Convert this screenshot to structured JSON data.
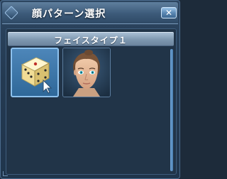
{
  "window": {
    "title": "顔パターン選択",
    "close_symbol": "✕"
  },
  "category": {
    "label": "フェイスタイプ１"
  },
  "faces": [
    {
      "id": "random",
      "icon": "dice-icon",
      "selected": true
    },
    {
      "id": "face-1",
      "icon": "face-portrait",
      "selected": false
    }
  ],
  "icons": {
    "close": "close-icon",
    "dice": "dice-icon",
    "cursor": "cursor-icon"
  },
  "colors": {
    "accent": "#8ec2ee",
    "header": "#7e97af",
    "window_bg": "#2c4560"
  },
  "scroll": {
    "position": 0
  }
}
